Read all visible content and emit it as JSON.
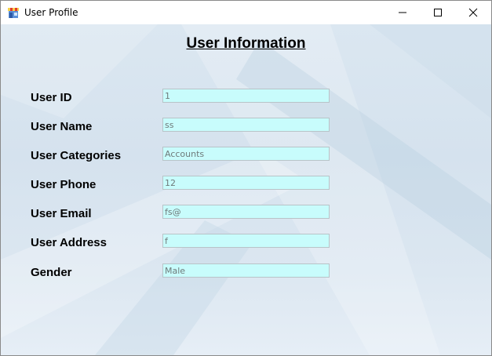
{
  "window": {
    "title": "User Profile",
    "icon": "store-icon"
  },
  "form": {
    "heading": "User Information",
    "fields": [
      {
        "label": "User ID",
        "value": "1"
      },
      {
        "label": "User Name",
        "value": "ss"
      },
      {
        "label": "User Categories",
        "value": "Accounts"
      },
      {
        "label": "User Phone",
        "value": "12"
      },
      {
        "label": "User Email",
        "value": "fs@"
      },
      {
        "label": "User Address",
        "value": "f"
      },
      {
        "label": "Gender",
        "value": "Male"
      }
    ]
  },
  "colors": {
    "field_background": "#c8fcfc",
    "client_background": "#d8e4ef"
  }
}
